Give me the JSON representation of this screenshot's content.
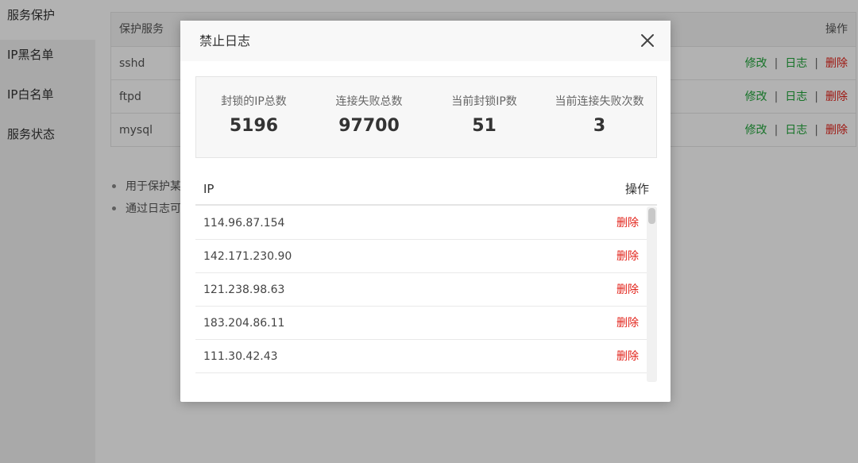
{
  "sidebar": {
    "items": [
      {
        "label": "服务保护"
      },
      {
        "label": "IP黑名单"
      },
      {
        "label": "IP白名单"
      },
      {
        "label": "服务状态"
      }
    ]
  },
  "service_table": {
    "col_service": "保护服务",
    "col_ops": "操作",
    "rows": [
      {
        "name": "sshd"
      },
      {
        "name": "ftpd"
      },
      {
        "name": "mysql"
      }
    ],
    "edit_label": "修改",
    "log_label": "日志",
    "delete_label": "删除",
    "separator": "|"
  },
  "notes": [
    "用于保护某",
    "通过日志可"
  ],
  "modal": {
    "title": "禁止日志",
    "close_icon": "close-icon",
    "stats": [
      {
        "label": "封锁的IP总数",
        "value": "5196"
      },
      {
        "label": "连接失败总数",
        "value": "97700"
      },
      {
        "label": "当前封锁IP数",
        "value": "51"
      },
      {
        "label": "当前连接失败次数",
        "value": "3"
      }
    ],
    "ip_table": {
      "col_ip": "IP",
      "col_ops": "操作",
      "delete_label": "删除",
      "rows": [
        {
          "ip": "114.96.87.154"
        },
        {
          "ip": "142.171.230.90"
        },
        {
          "ip": "121.238.98.63"
        },
        {
          "ip": "183.204.86.11"
        },
        {
          "ip": "111.30.42.43"
        }
      ]
    }
  },
  "colors": {
    "accent_green": "#20a53a",
    "danger_red": "#e2231a"
  }
}
